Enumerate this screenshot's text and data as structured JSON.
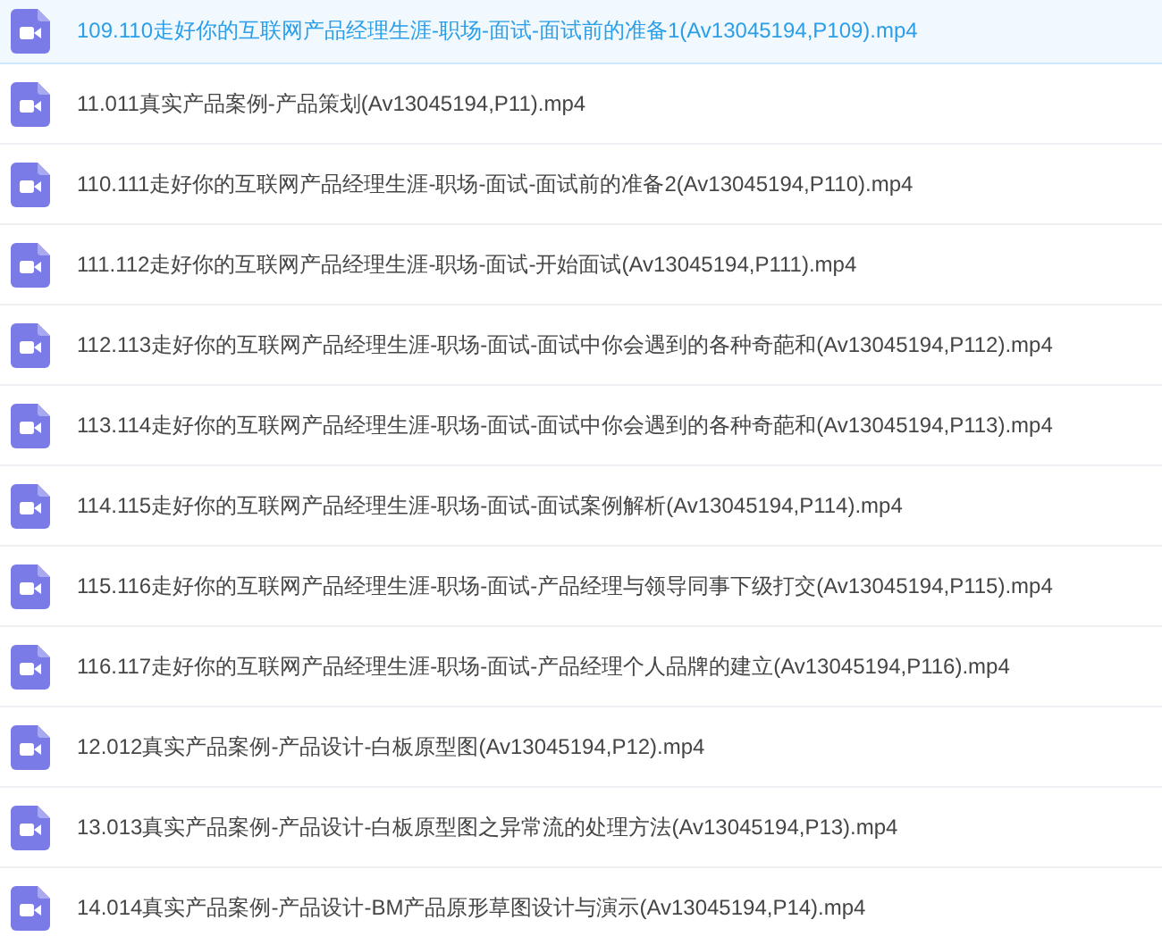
{
  "files": [
    {
      "name": "109.110走好你的互联网产品经理生涯-职场-面试-面试前的准备1(Av13045194,P109).mp4",
      "selected": true
    },
    {
      "name": "11.011真实产品案例-产品策划(Av13045194,P11).mp4",
      "selected": false
    },
    {
      "name": "110.111走好你的互联网产品经理生涯-职场-面试-面试前的准备2(Av13045194,P110).mp4",
      "selected": false
    },
    {
      "name": "111.112走好你的互联网产品经理生涯-职场-面试-开始面试(Av13045194,P111).mp4",
      "selected": false
    },
    {
      "name": "112.113走好你的互联网产品经理生涯-职场-面试-面试中你会遇到的各种奇葩和(Av13045194,P112).mp4",
      "selected": false
    },
    {
      "name": "113.114走好你的互联网产品经理生涯-职场-面试-面试中你会遇到的各种奇葩和(Av13045194,P113).mp4",
      "selected": false
    },
    {
      "name": "114.115走好你的互联网产品经理生涯-职场-面试-面试案例解析(Av13045194,P114).mp4",
      "selected": false
    },
    {
      "name": "115.116走好你的互联网产品经理生涯-职场-面试-产品经理与领导同事下级打交(Av13045194,P115).mp4",
      "selected": false
    },
    {
      "name": "116.117走好你的互联网产品经理生涯-职场-面试-产品经理个人品牌的建立(Av13045194,P116).mp4",
      "selected": false
    },
    {
      "name": "12.012真实产品案例-产品设计-白板原型图(Av13045194,P12).mp4",
      "selected": false
    },
    {
      "name": "13.013真实产品案例-产品设计-白板原型图之异常流的处理方法(Av13045194,P13).mp4",
      "selected": false
    },
    {
      "name": "14.014真实产品案例-产品设计-BM产品原形草图设计与演示(Av13045194,P14).mp4",
      "selected": false
    }
  ]
}
